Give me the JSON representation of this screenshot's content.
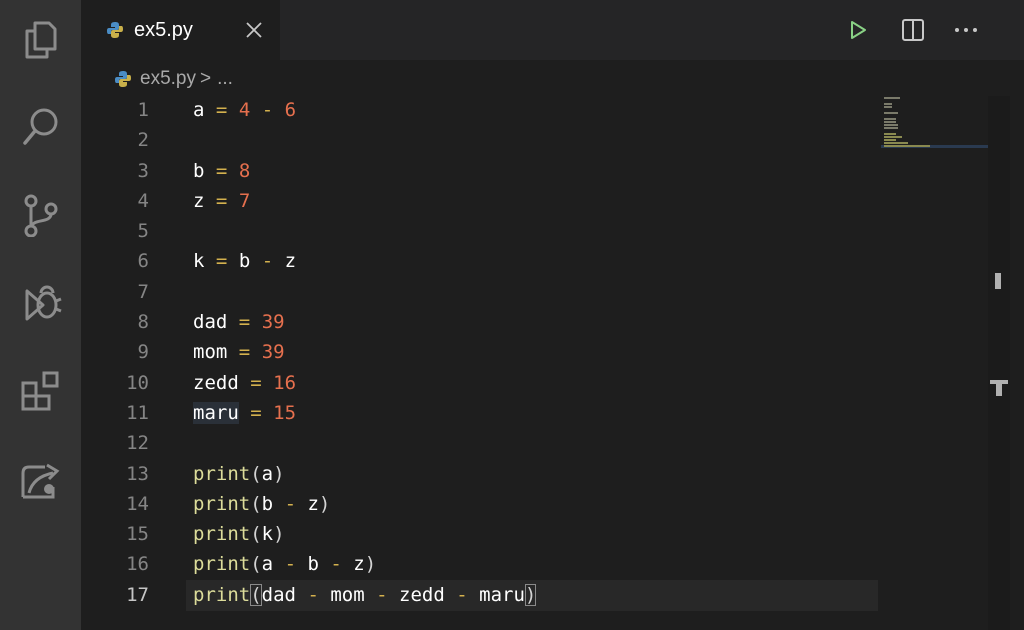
{
  "activity_bar": {
    "icons": [
      "explorer-icon",
      "search-icon",
      "source-control-icon",
      "run-debug-icon",
      "extensions-icon",
      "remote-icon"
    ]
  },
  "tab": {
    "title": "ex5.py"
  },
  "toolbar": {
    "actions": [
      "run-icon",
      "split-editor-icon",
      "more-actions-icon"
    ]
  },
  "breadcrumb": {
    "file": "ex5.py",
    "separator": ">",
    "rest": "..."
  },
  "editor": {
    "current_line": 17,
    "lines": [
      "a = 4 - 6",
      "",
      "b = 8",
      "z = 7",
      "",
      "k = b - z",
      "",
      "dad = 39",
      "mom = 39",
      "zedd = 16",
      "maru = 15",
      "",
      "print(a)",
      "print(b - z)",
      "print(k)",
      "print(a - b - z)",
      "print(dad - mom - zedd - maru)"
    ]
  },
  "colors": {
    "background": "#1e1e1e",
    "activity_bar": "#333333",
    "variable": "#ffffff",
    "operator": "#d4b14e",
    "number": "#e6704e",
    "function": "#dcdc9a",
    "line_number": "#858585",
    "run_icon": "#89d185"
  }
}
